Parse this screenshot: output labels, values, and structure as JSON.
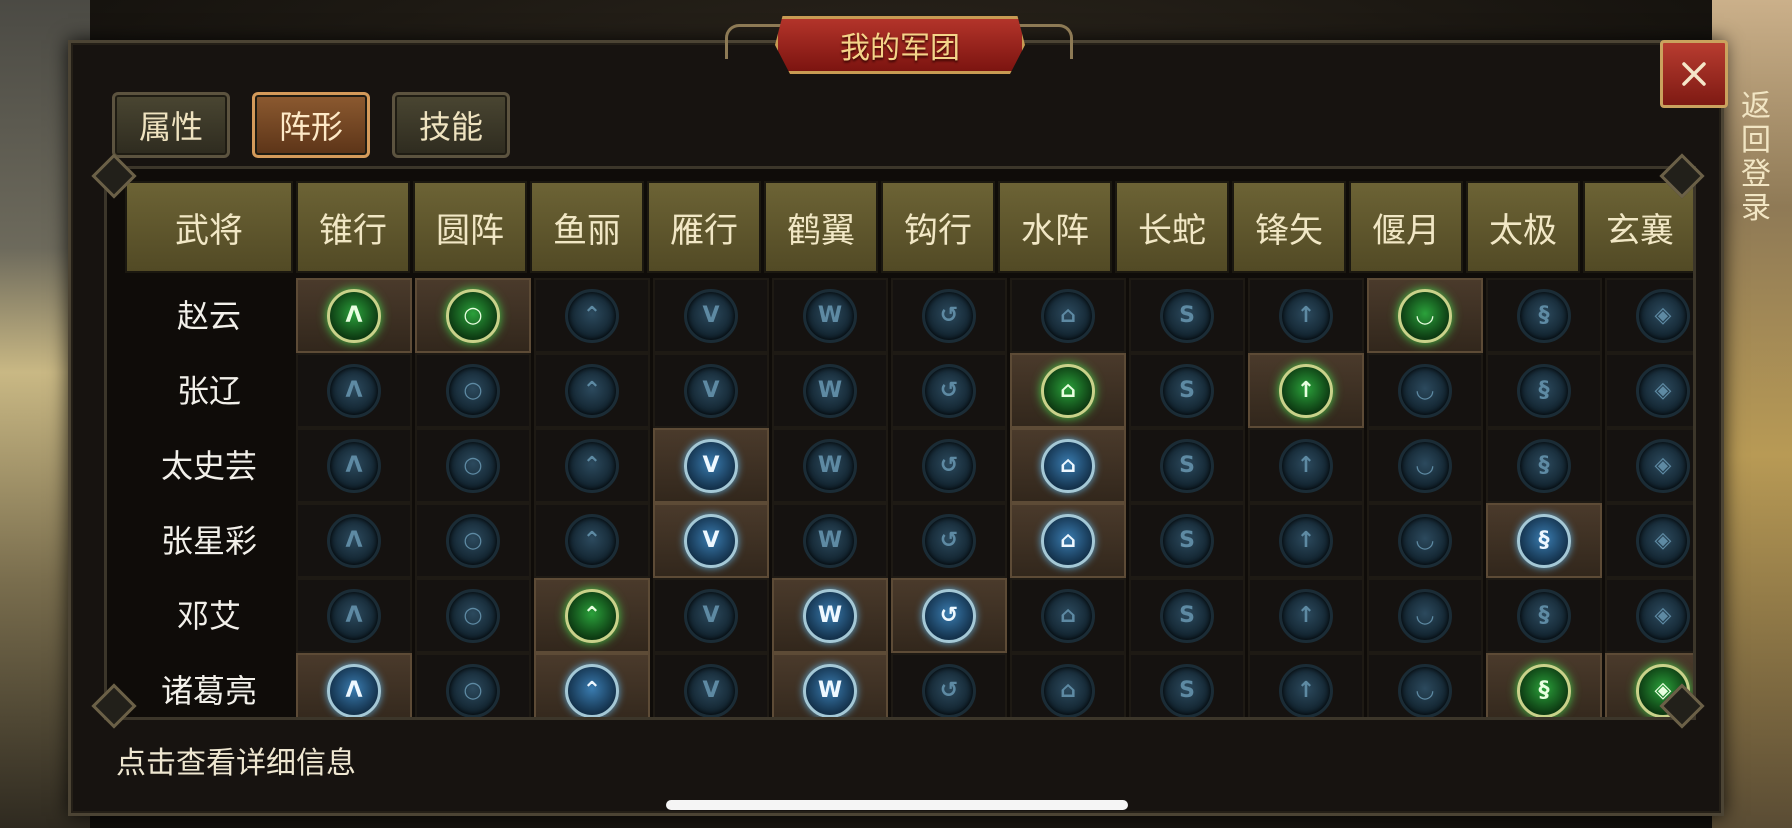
{
  "window": {
    "title": "我的军团"
  },
  "tabs": [
    {
      "label": "属性",
      "active": false
    },
    {
      "label": "阵形",
      "active": true
    },
    {
      "label": "技能",
      "active": false
    }
  ],
  "side_text": "返回\n登录",
  "table": {
    "header_first": "武将",
    "formations": [
      "锥行",
      "圆阵",
      "鱼丽",
      "雁行",
      "鹤翼",
      "钩行",
      "水阵",
      "长蛇",
      "锋矢",
      "偃月",
      "太极",
      "玄襄"
    ],
    "formation_icons": [
      "arrowhead-icon",
      "circle-icon",
      "double-chevron-icon",
      "v-icon",
      "w-icon",
      "hook-icon",
      "pentagon-icon",
      "s-icon",
      "up-arrow-icon",
      "crescent-icon",
      "taiji-icon",
      "diamond-icon"
    ],
    "rows": [
      {
        "name": "赵云",
        "states": [
          "green",
          "green",
          "off",
          "off",
          "off",
          "off",
          "off",
          "off",
          "off",
          "green",
          "off",
          "off"
        ]
      },
      {
        "name": "张辽",
        "states": [
          "off",
          "off",
          "off",
          "off",
          "off",
          "off",
          "green",
          "off",
          "green",
          "off",
          "off",
          "off"
        ]
      },
      {
        "name": "太史芸",
        "states": [
          "off",
          "off",
          "off",
          "blue",
          "off",
          "off",
          "blue",
          "off",
          "off",
          "off",
          "off",
          "off"
        ]
      },
      {
        "name": "张星彩",
        "states": [
          "off",
          "off",
          "off",
          "blue",
          "off",
          "off",
          "blue",
          "off",
          "off",
          "off",
          "blue",
          "off"
        ]
      },
      {
        "name": "邓艾",
        "states": [
          "off",
          "off",
          "green",
          "off",
          "blue",
          "blue",
          "off",
          "off",
          "off",
          "off",
          "off",
          "off"
        ]
      },
      {
        "name": "诸葛亮",
        "states": [
          "blue",
          "off",
          "blue",
          "off",
          "blue",
          "off",
          "off",
          "off",
          "off",
          "off",
          "green",
          "green"
        ]
      }
    ]
  },
  "footer": {
    "hint": "点击查看详细信息"
  },
  "colors": {
    "active_green": "#49d04c",
    "active_blue": "#5ea6d1",
    "title_red": "#b3342a"
  }
}
